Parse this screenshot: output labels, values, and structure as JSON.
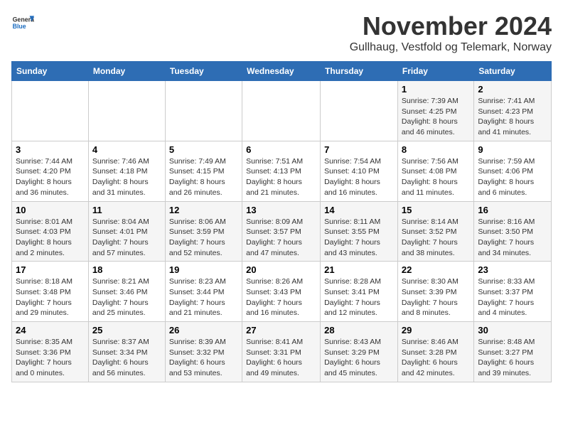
{
  "logo": {
    "general": "General",
    "blue": "Blue"
  },
  "title": "November 2024",
  "subtitle": "Gullhaug, Vestfold og Telemark, Norway",
  "days_of_week": [
    "Sunday",
    "Monday",
    "Tuesday",
    "Wednesday",
    "Thursday",
    "Friday",
    "Saturday"
  ],
  "weeks": [
    [
      {
        "day": "",
        "detail": ""
      },
      {
        "day": "",
        "detail": ""
      },
      {
        "day": "",
        "detail": ""
      },
      {
        "day": "",
        "detail": ""
      },
      {
        "day": "",
        "detail": ""
      },
      {
        "day": "1",
        "detail": "Sunrise: 7:39 AM\nSunset: 4:25 PM\nDaylight: 8 hours and 46 minutes."
      },
      {
        "day": "2",
        "detail": "Sunrise: 7:41 AM\nSunset: 4:23 PM\nDaylight: 8 hours and 41 minutes."
      }
    ],
    [
      {
        "day": "3",
        "detail": "Sunrise: 7:44 AM\nSunset: 4:20 PM\nDaylight: 8 hours and 36 minutes."
      },
      {
        "day": "4",
        "detail": "Sunrise: 7:46 AM\nSunset: 4:18 PM\nDaylight: 8 hours and 31 minutes."
      },
      {
        "day": "5",
        "detail": "Sunrise: 7:49 AM\nSunset: 4:15 PM\nDaylight: 8 hours and 26 minutes."
      },
      {
        "day": "6",
        "detail": "Sunrise: 7:51 AM\nSunset: 4:13 PM\nDaylight: 8 hours and 21 minutes."
      },
      {
        "day": "7",
        "detail": "Sunrise: 7:54 AM\nSunset: 4:10 PM\nDaylight: 8 hours and 16 minutes."
      },
      {
        "day": "8",
        "detail": "Sunrise: 7:56 AM\nSunset: 4:08 PM\nDaylight: 8 hours and 11 minutes."
      },
      {
        "day": "9",
        "detail": "Sunrise: 7:59 AM\nSunset: 4:06 PM\nDaylight: 8 hours and 6 minutes."
      }
    ],
    [
      {
        "day": "10",
        "detail": "Sunrise: 8:01 AM\nSunset: 4:03 PM\nDaylight: 8 hours and 2 minutes."
      },
      {
        "day": "11",
        "detail": "Sunrise: 8:04 AM\nSunset: 4:01 PM\nDaylight: 7 hours and 57 minutes."
      },
      {
        "day": "12",
        "detail": "Sunrise: 8:06 AM\nSunset: 3:59 PM\nDaylight: 7 hours and 52 minutes."
      },
      {
        "day": "13",
        "detail": "Sunrise: 8:09 AM\nSunset: 3:57 PM\nDaylight: 7 hours and 47 minutes."
      },
      {
        "day": "14",
        "detail": "Sunrise: 8:11 AM\nSunset: 3:55 PM\nDaylight: 7 hours and 43 minutes."
      },
      {
        "day": "15",
        "detail": "Sunrise: 8:14 AM\nSunset: 3:52 PM\nDaylight: 7 hours and 38 minutes."
      },
      {
        "day": "16",
        "detail": "Sunrise: 8:16 AM\nSunset: 3:50 PM\nDaylight: 7 hours and 34 minutes."
      }
    ],
    [
      {
        "day": "17",
        "detail": "Sunrise: 8:18 AM\nSunset: 3:48 PM\nDaylight: 7 hours and 29 minutes."
      },
      {
        "day": "18",
        "detail": "Sunrise: 8:21 AM\nSunset: 3:46 PM\nDaylight: 7 hours and 25 minutes."
      },
      {
        "day": "19",
        "detail": "Sunrise: 8:23 AM\nSunset: 3:44 PM\nDaylight: 7 hours and 21 minutes."
      },
      {
        "day": "20",
        "detail": "Sunrise: 8:26 AM\nSunset: 3:43 PM\nDaylight: 7 hours and 16 minutes."
      },
      {
        "day": "21",
        "detail": "Sunrise: 8:28 AM\nSunset: 3:41 PM\nDaylight: 7 hours and 12 minutes."
      },
      {
        "day": "22",
        "detail": "Sunrise: 8:30 AM\nSunset: 3:39 PM\nDaylight: 7 hours and 8 minutes."
      },
      {
        "day": "23",
        "detail": "Sunrise: 8:33 AM\nSunset: 3:37 PM\nDaylight: 7 hours and 4 minutes."
      }
    ],
    [
      {
        "day": "24",
        "detail": "Sunrise: 8:35 AM\nSunset: 3:36 PM\nDaylight: 7 hours and 0 minutes."
      },
      {
        "day": "25",
        "detail": "Sunrise: 8:37 AM\nSunset: 3:34 PM\nDaylight: 6 hours and 56 minutes."
      },
      {
        "day": "26",
        "detail": "Sunrise: 8:39 AM\nSunset: 3:32 PM\nDaylight: 6 hours and 53 minutes."
      },
      {
        "day": "27",
        "detail": "Sunrise: 8:41 AM\nSunset: 3:31 PM\nDaylight: 6 hours and 49 minutes."
      },
      {
        "day": "28",
        "detail": "Sunrise: 8:43 AM\nSunset: 3:29 PM\nDaylight: 6 hours and 45 minutes."
      },
      {
        "day": "29",
        "detail": "Sunrise: 8:46 AM\nSunset: 3:28 PM\nDaylight: 6 hours and 42 minutes."
      },
      {
        "day": "30",
        "detail": "Sunrise: 8:48 AM\nSunset: 3:27 PM\nDaylight: 6 hours and 39 minutes."
      }
    ]
  ]
}
